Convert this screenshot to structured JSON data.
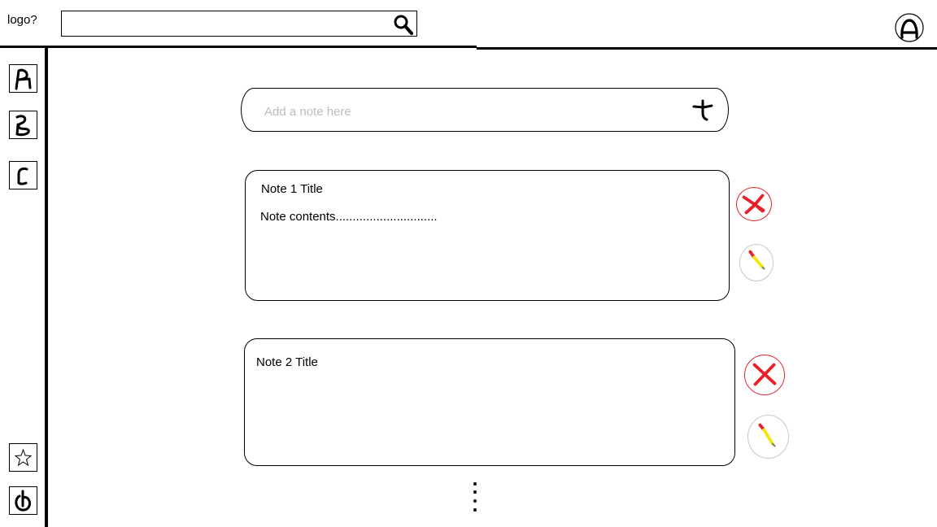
{
  "header": {
    "logo_text": "logo?",
    "search": {
      "value": "",
      "placeholder": ""
    }
  },
  "composer": {
    "placeholder": "Add a note here"
  },
  "notes": [
    {
      "title": "Note 1 Title",
      "contents": "Note contents.............................."
    },
    {
      "title": "Note 2 Title",
      "contents": ""
    }
  ],
  "sidebar": {
    "items": [
      {
        "icon": "letter-a-icon"
      },
      {
        "icon": "letter-b-icon"
      },
      {
        "icon": "letter-c-icon"
      }
    ],
    "bottom": [
      {
        "icon": "star-icon"
      },
      {
        "icon": "power-icon"
      }
    ]
  },
  "colors": {
    "delete": "#e8202a",
    "edit_body": "#f5e60a",
    "edit_tip": "#e8202a"
  }
}
